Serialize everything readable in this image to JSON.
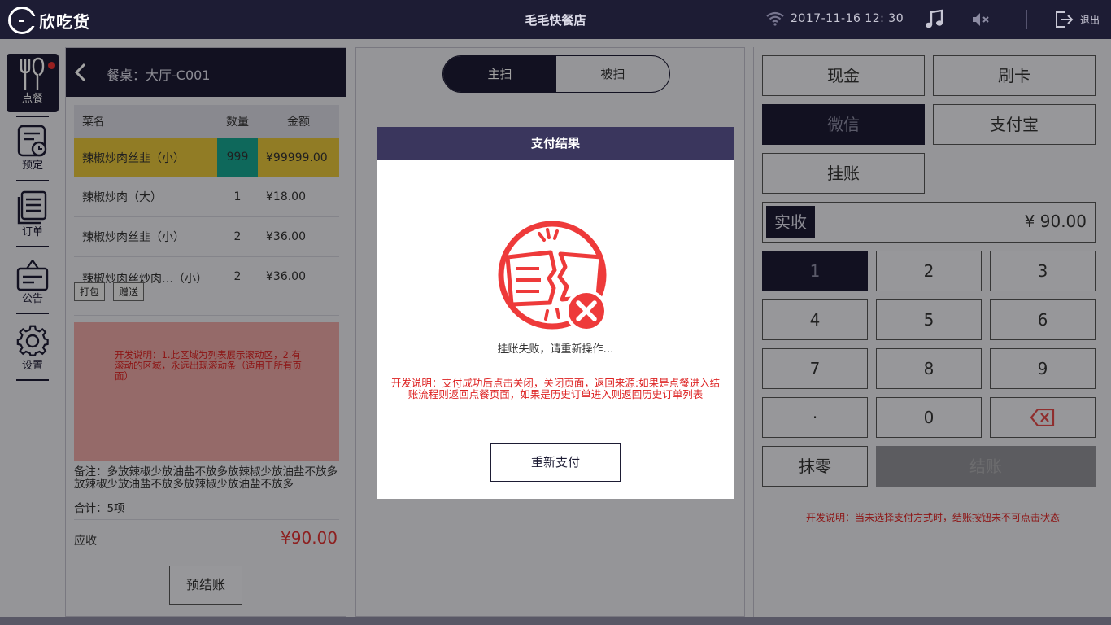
{
  "topbar": {
    "logo_text": "欣吃货",
    "shop_name": "毛毛快餐店",
    "datetime": "2017-11-16  12: 30",
    "exit_label": "退出"
  },
  "nav": {
    "items": [
      {
        "label": "点餐",
        "icon": "utensils-icon"
      },
      {
        "label": "预定",
        "icon": "clock-calendar-icon"
      },
      {
        "label": "订单",
        "icon": "order-list-icon"
      },
      {
        "label": "公告",
        "icon": "notice-icon"
      },
      {
        "label": "设置",
        "icon": "gear-icon"
      }
    ]
  },
  "order": {
    "table_label": "餐桌：大厅-C001",
    "columns": [
      "菜名",
      "数量",
      "金额"
    ],
    "rows": [
      {
        "name": "辣椒炒肉丝韭（小）",
        "qty": "999",
        "amount": "¥99999.00"
      },
      {
        "name": "辣椒炒肉（大）",
        "qty": "1",
        "amount": "¥18.00"
      },
      {
        "name": "辣椒炒肉丝韭（小）",
        "qty": "2",
        "amount": "¥36.00"
      },
      {
        "name": "辣椒炒肉丝炒肉…（小）",
        "qty": "2",
        "amount": "¥36.00"
      }
    ],
    "tags": [
      "打包",
      "赠送"
    ],
    "dev_note": "开发说明：1.此区域为列表展示滚动区，2.有滚动的区域，永远出现滚动条（适用于所有页面）",
    "remark": "备注：多放辣椒少放油盐不放多放辣椒少放油盐不放多放辣椒少放油盐不放多放辣椒少放油盐不放多",
    "total": "合计：5项",
    "receivable_label": "应收",
    "receivable_value": "¥90.00",
    "prebill_label": "预结账"
  },
  "scan": {
    "options": [
      "主扫",
      "被扫"
    ]
  },
  "payment": {
    "methods": [
      "现金",
      "刷卡",
      "微信",
      "支付宝",
      "挂账"
    ],
    "amount_label": "实收",
    "amount_value": "¥ 90.00",
    "keys": [
      "1",
      "2",
      "3",
      "4",
      "5",
      "6",
      "7",
      "8",
      "9",
      "·",
      "0"
    ],
    "erase_label": "抹零",
    "checkout_label": "结账",
    "note": "开发说明：当未选择支付方式时，结账按钮未不可点击状态"
  },
  "dialog": {
    "title": "支付结果",
    "message": "挂账失败，请重新操作…",
    "dev_note": "开发说明：支付成功后点击关闭，关闭页面，返回来源:如果是点餐进入结账流程则返回点餐页面，如果是历史订单进入则返回历史订单列表",
    "retry_label": "重新支付"
  },
  "colors": {
    "primary": "#1d1c34",
    "dialog_header": "#3a365d",
    "error": "#ee3a3a",
    "highlight_row": "#e3c23a",
    "qty_cell": "#17a38f"
  }
}
